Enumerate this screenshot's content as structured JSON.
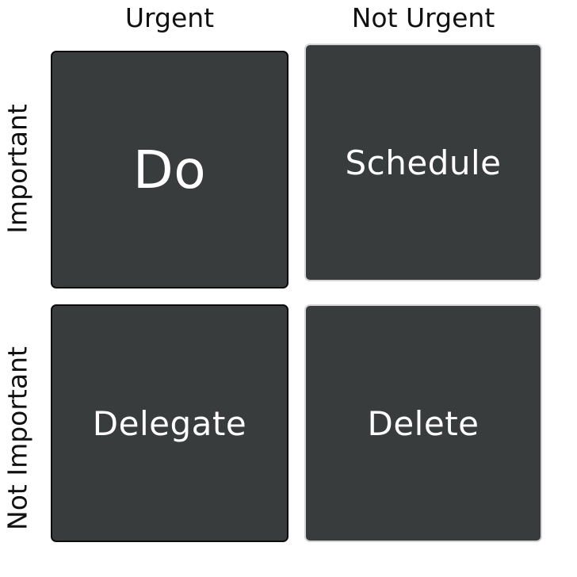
{
  "columns": {
    "urgent": "Urgent",
    "not_urgent": "Not Urgent"
  },
  "rows": {
    "important": "Important",
    "not_important": "Not Important"
  },
  "quadrants": {
    "do": "Do",
    "schedule": "Schedule",
    "delegate": "Delegate",
    "delete": "Delete"
  },
  "colors": {
    "quadrant_fill": "#393c3d",
    "label_text": "#ffffff",
    "header_text": "#111111"
  }
}
